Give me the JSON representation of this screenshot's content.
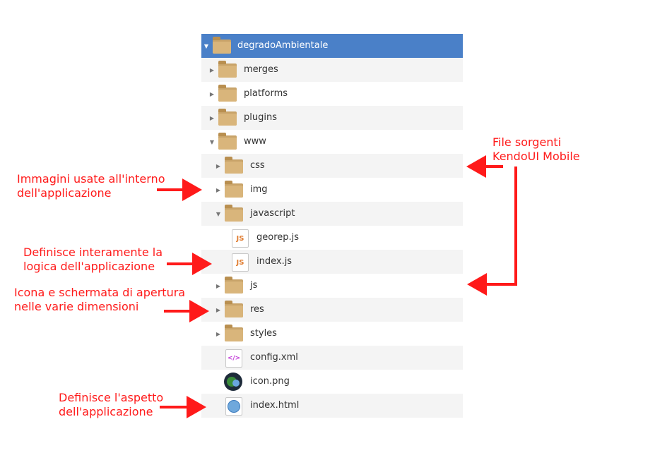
{
  "tree": {
    "rows": [
      {
        "label": "degradoAmbientale",
        "type": "folder",
        "expander": "down",
        "selected": true
      },
      {
        "label": "merges",
        "type": "folder",
        "expander": "right"
      },
      {
        "label": "platforms",
        "type": "folder",
        "expander": "right"
      },
      {
        "label": "plugins",
        "type": "folder",
        "expander": "right"
      },
      {
        "label": "www",
        "type": "folder",
        "expander": "down"
      },
      {
        "label": "css",
        "type": "folder",
        "expander": "right"
      },
      {
        "label": "img",
        "type": "folder",
        "expander": "right"
      },
      {
        "label": "javascript",
        "type": "folder",
        "expander": "down"
      },
      {
        "label": "georep.js",
        "type": "js"
      },
      {
        "label": "index.js",
        "type": "js"
      },
      {
        "label": "js",
        "type": "folder",
        "expander": "right"
      },
      {
        "label": "res",
        "type": "folder",
        "expander": "right"
      },
      {
        "label": "styles",
        "type": "folder",
        "expander": "right"
      },
      {
        "label": "config.xml",
        "type": "xml"
      },
      {
        "label": "icon.png",
        "type": "png"
      },
      {
        "label": "index.html",
        "type": "html"
      }
    ],
    "icon_text": {
      "js": "JS",
      "xml": "</>"
    }
  },
  "annotations": {
    "img_note": [
      "Immagini usate all'interno",
      "dell'applicazione"
    ],
    "indexjs_note": [
      "Definisce interamente la",
      "logica dell'applicazione"
    ],
    "res_note": [
      "Icona e schermata di apertura",
      "nelle varie dimensioni"
    ],
    "indexhtml_note": [
      "Definisce l'aspetto",
      "dell'applicazione"
    ],
    "kendo_note": [
      "File sorgenti",
      "KendoUI Mobile"
    ]
  },
  "colors": {
    "annotation": "#ff1a1a",
    "selection": "#4a80c8",
    "folder": "#d9b57b"
  }
}
